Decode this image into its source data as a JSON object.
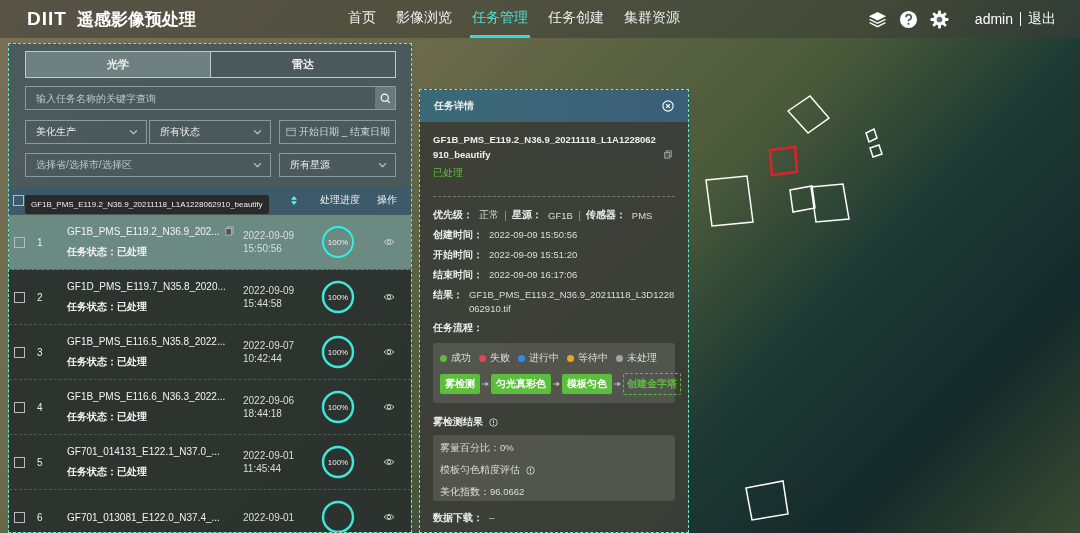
{
  "header": {
    "logo": "DIIT",
    "title": "遥感影像预处理",
    "nav": [
      {
        "label": "首页",
        "selected": false
      },
      {
        "label": "影像浏览",
        "selected": false
      },
      {
        "label": "任务管理",
        "selected": true
      },
      {
        "label": "任务创建",
        "selected": false
      },
      {
        "label": "集群资源",
        "selected": false
      }
    ],
    "user": "admin",
    "logout": "退出"
  },
  "left_panel": {
    "tabs": [
      {
        "label": "光学",
        "selected": true
      },
      {
        "label": "雷达",
        "selected": false
      }
    ],
    "search": {
      "placeholder": "输入任务名称的关键字查询"
    },
    "filters": [
      {
        "kind": "select",
        "value": "美化生产"
      },
      {
        "kind": "select",
        "value": "所有状态"
      },
      {
        "kind": "daterange",
        "start_placeholder": "开始日期",
        "separator": "_",
        "end_placeholder": "结束日期"
      },
      {
        "kind": "select",
        "placeholder": "选择省/选择市/选择区"
      },
      {
        "kind": "select",
        "value": "所有星源"
      }
    ],
    "table": {
      "header_checked": false,
      "columns": [
        {
          "label": "处理进度"
        },
        {
          "label": "操作"
        }
      ],
      "tooltip": "GF1B_PMS_E119.2_N36.9_20211118_L1A1228062910_beautify",
      "rows": [
        {
          "index": "1",
          "name": "GF1B_PMS_E119.2_N36.9_202...",
          "status_label": "任务状态：",
          "status": "已处理",
          "date": "2022-09-09",
          "time": "15:50:56",
          "progress": "100%",
          "level": 1,
          "checked": false,
          "selected": true
        },
        {
          "index": "2",
          "name": "GF1D_PMS_E119.7_N35.8_2020...",
          "status_label": "任务状态：",
          "status": "已处理",
          "date": "2022-09-09",
          "time": "15:44:58",
          "progress": "100%",
          "level": 1,
          "checked": false,
          "selected": false
        },
        {
          "index": "3",
          "name": "GF1B_PMS_E116.5_N35.8_2022...",
          "status_label": "任务状态：",
          "status": "已处理",
          "date": "2022-09-07",
          "time": "10:42:44",
          "progress": "100%",
          "level": 1,
          "checked": false,
          "selected": false
        },
        {
          "index": "4",
          "name": "GF1B_PMS_E116.6_N36.3_2022...",
          "status_label": "任务状态：",
          "status": "已处理",
          "date": "2022-09-06",
          "time": "18:44:18",
          "progress": "100%",
          "level": 1,
          "checked": false,
          "selected": false
        },
        {
          "index": "5",
          "name": "GF701_014131_E122.1_N37.0_...",
          "status_label": "任务状态：",
          "status": "已处理",
          "date": "2022-09-01",
          "time": "11:45:44",
          "progress": "100%",
          "level": 1,
          "checked": false,
          "selected": false
        },
        {
          "index": "6",
          "name": "GF701_013081_E122.0_N37.4_...",
          "date": "2022-09-01",
          "level": 1,
          "checked": false,
          "selected": false
        }
      ]
    }
  },
  "detail_panel": {
    "title": "任务详情",
    "name": "GF1B_PMS_E119.2_N36.9_20211118_L1A1228062910_beautify",
    "status": "已处理",
    "meta": [
      {
        "label": "优先级：",
        "value": "正常"
      },
      {
        "label": "星源：",
        "value": "GF1B"
      },
      {
        "label": "传感器：",
        "value": "PMS"
      }
    ],
    "times": [
      {
        "label": "创建时间：",
        "value": "2022-09-09 15:50:56"
      },
      {
        "label": "开始时间：",
        "value": "2022-09-09 15:51:20"
      },
      {
        "label": "结束时间：",
        "value": "2022-09-09 16:17:06"
      }
    ],
    "result": {
      "label": "结果：",
      "value": "GF1B_PMS_E119.2_N36.9_20211118_L3D1228062910.tif"
    },
    "flow_title": "任务流程：",
    "legend": [
      {
        "label": "成功",
        "color": "#5cbf3c"
      },
      {
        "label": "失败",
        "color": "#e8405a"
      },
      {
        "label": "进行中",
        "color": "#2d8cf0"
      },
      {
        "label": "等待中",
        "color": "#f0a030"
      },
      {
        "label": "未处理",
        "color": "#a0a4a8"
      }
    ],
    "steps": [
      {
        "label": "雾检测",
        "kind": "done"
      },
      {
        "label": "匀光真彩色",
        "kind": "done"
      },
      {
        "label": "模板匀色",
        "kind": "done"
      },
      {
        "label": "创建金字塔",
        "kind": "pending"
      }
    ],
    "fog_title": "雾检测结果",
    "fog_lines": [
      {
        "text": "雾量百分比：0%",
        "info": false
      },
      {
        "text": "模板匀色精度评估",
        "info": true
      },
      {
        "text": "美化指数：96.0662",
        "info": false
      }
    ],
    "download_label": "数据下载：",
    "download_value": "–"
  }
}
